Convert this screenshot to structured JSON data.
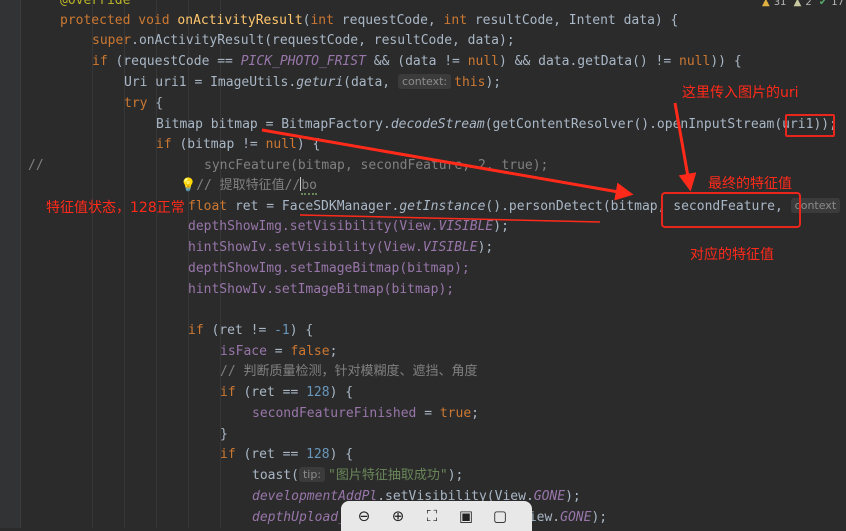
{
  "inspection": {
    "warnings": "31",
    "weak_warnings": "2",
    "ok": "17"
  },
  "lines": {
    "l0": "@Override",
    "l1": {
      "kw1": "protected",
      "kw2": "void",
      "method": "onActivityResult",
      "p1t": "int",
      "p1": "requestCode",
      "p2t": "int",
      "p2": "resultCode",
      "p3": "Intent data) {"
    },
    "l2": {
      "kw": "super",
      "rest": ".onActivityResult(requestCode, resultCode, data);"
    },
    "l3": {
      "kw": "if",
      "a": " (requestCode == ",
      "const": "PICK_PHOTO_FRIST",
      "b": " && (data != ",
      "null1": "null",
      "c": ") && data.getData() != ",
      "null2": "null",
      "d": ")) {"
    },
    "l4": {
      "a": "Uri uri1 = ImageUtils.",
      "method": "geturi",
      "b": "(data, ",
      "hint": "context:",
      "kw": "this",
      "c": ");"
    },
    "l5": {
      "kw": "try",
      "rest": " {"
    },
    "l6": {
      "a": "Bitmap bitmap = BitmapFactory.",
      "method": "decodeStream",
      "b": "(getContentResolver().openInputStream(uri1));"
    },
    "l7": {
      "kw": "if",
      "a": " (bitmap != ",
      "null": "null",
      "b": ") {"
    },
    "l8": {
      "slashes": "//",
      "a": "syncFeature(bitmap, secondFeature, ",
      "num": "2",
      "b": ", ",
      "kw": "true",
      "c": ");"
    },
    "l9": {
      "cmt": "// 提取特征值//",
      "tail": "bo"
    },
    "l10": {
      "kw": "float",
      "a": " ret = FaceSDKManager.",
      "method": "getInstance",
      "b": "().personDetect(bitmap, secondFeature, ",
      "hint": "context"
    },
    "l11": {
      "a": "depthShowImg.setVisibility(View.",
      "const": "VISIBLE",
      "b": ");"
    },
    "l12": {
      "a": "hintShowIv.setVisibility(View.",
      "const": "VISIBLE",
      "b": ");"
    },
    "l13": "depthShowImg.setImageBitmap(bitmap);",
    "l14": "hintShowIv.setImageBitmap(bitmap);",
    "l16": {
      "kw": "if",
      "a": " (ret != ",
      "num": "-1",
      "b": ") {"
    },
    "l17": {
      "field": "isFace",
      "a": " = ",
      "kw": "false",
      "b": ";"
    },
    "l18": "// 判断质量检测，针对模糊度、遮挡、角度",
    "l19": {
      "kw": "if",
      "a": " (ret == ",
      "num": "128",
      "b": ") {"
    },
    "l20": {
      "field": "secondFeatureFinished",
      "a": " = ",
      "kw": "true",
      "b": ";"
    },
    "l21": "}",
    "l22": {
      "kw": "if",
      "a": " (ret == ",
      "num": "128",
      "b": ") {"
    },
    "l23": {
      "a": "toast(",
      "hint": "tip:",
      "str": "\"图片特征抽取成功\"",
      "b": ");"
    },
    "l24": {
      "field": "developmentAddPl",
      "a": ".setVisibility(View.",
      "const": "GONE",
      "b": ");"
    },
    "l25": {
      "field": "depthUpload_",
      "const": "GONE",
      "b": ");",
      "a": "View."
    }
  },
  "annotations": {
    "uri_note": "这里传入图片的uri",
    "final_note": "最终的特征值",
    "status_note": "特征值状态，128正常",
    "corresponding_note": "对应的特征值",
    "color": "#ff2a1a"
  },
  "toolbar": {
    "buttons": [
      {
        "name": "zoom-out",
        "glyph": "⊖"
      },
      {
        "name": "zoom-in",
        "glyph": "⊕"
      },
      {
        "name": "fit-screen",
        "glyph": "⛶"
      },
      {
        "name": "present",
        "glyph": "▣"
      },
      {
        "name": "comment",
        "glyph": "▢"
      }
    ]
  }
}
